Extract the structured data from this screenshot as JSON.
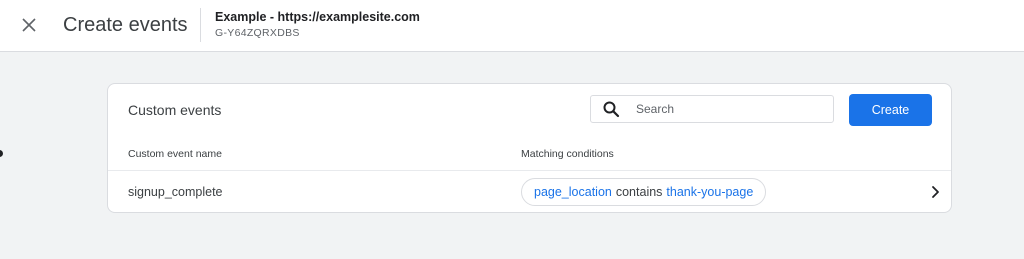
{
  "header": {
    "close_icon": "close-icon",
    "title": "Create events",
    "property_name": "Example - https://examplesite.com",
    "property_id": "G-Y64ZQRXDBS"
  },
  "card": {
    "title": "Custom events",
    "search": {
      "placeholder": "Search",
      "value": "",
      "icon": "search-icon"
    },
    "create_label": "Create",
    "columns": [
      "Custom event name",
      "Matching conditions"
    ],
    "rows": [
      {
        "event_name": "signup_complete",
        "condition": {
          "parameter": "page_location",
          "operator": "contains",
          "value": "thank-you-page"
        },
        "chevron_icon": "chevron-right-icon"
      }
    ]
  },
  "colors": {
    "accent": "#1a73e8",
    "background": "#f1f3f4",
    "border": "#dadce0"
  }
}
